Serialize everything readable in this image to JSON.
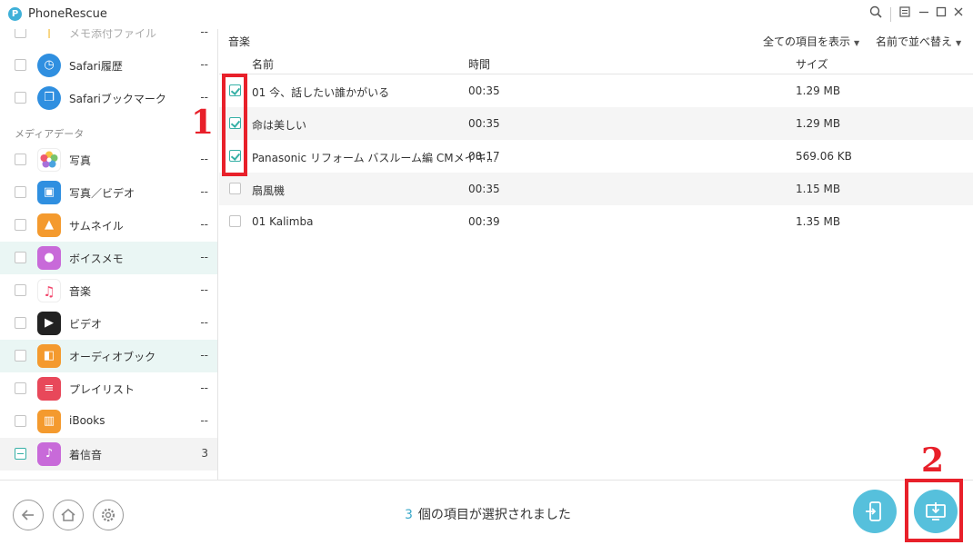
{
  "app": {
    "title": "PhoneRescue",
    "logo_letter": "P"
  },
  "sidebar": {
    "section_media": "メディアデータ",
    "items": [
      {
        "label": "メモ添付ファイル",
        "count": "--",
        "icon": "attachment-icon",
        "color": "#f4c24a",
        "checked": "none"
      },
      {
        "label": "Safari履歴",
        "count": "--",
        "icon": "safari-history-icon",
        "color": "#2f8fe0",
        "checked": "none"
      },
      {
        "label": "Safariブックマーク",
        "count": "--",
        "icon": "safari-bookmark-icon",
        "color": "#2f8fe0",
        "checked": "none"
      },
      {
        "label": "写真",
        "count": "--",
        "icon": "photos-icon",
        "color": "#ffffff",
        "checked": "none"
      },
      {
        "label": "写真／ビデオ",
        "count": "--",
        "icon": "photo-video-icon",
        "color": "#2f8fe0",
        "checked": "none"
      },
      {
        "label": "サムネイル",
        "count": "--",
        "icon": "thumbnail-icon",
        "color": "#f49a2e",
        "checked": "none"
      },
      {
        "label": "ボイスメモ",
        "count": "--",
        "icon": "voice-memo-icon",
        "color": "#c86ad9",
        "checked": "none"
      },
      {
        "label": "音楽",
        "count": "--",
        "icon": "music-icon",
        "color": "#ffffff",
        "checked": "none"
      },
      {
        "label": "ビデオ",
        "count": "--",
        "icon": "video-icon",
        "color": "#222222",
        "checked": "none"
      },
      {
        "label": "オーディオブック",
        "count": "--",
        "icon": "audiobook-icon",
        "color": "#f49a2e",
        "checked": "none"
      },
      {
        "label": "プレイリスト",
        "count": "--",
        "icon": "playlist-icon",
        "color": "#e8485a",
        "checked": "none"
      },
      {
        "label": "iBooks",
        "count": "--",
        "icon": "ibooks-icon",
        "color": "#f49a2e",
        "checked": "none"
      },
      {
        "label": "着信音",
        "count": "3",
        "icon": "ringtone-icon",
        "color": "#c86ad9",
        "checked": "partial"
      }
    ]
  },
  "main": {
    "breadcrumb": "音楽",
    "filter_label": "全ての項目を表示",
    "sort_label": "名前で並べ替え",
    "columns": {
      "name": "名前",
      "time": "時間",
      "size": "サイズ"
    },
    "rows": [
      {
        "name": "01 今、話したい誰かがいる",
        "time": "00:35",
        "size": "1.29 MB",
        "checked": true
      },
      {
        "name": "命は美しい",
        "time": "00:35",
        "size": "1.29 MB",
        "checked": true
      },
      {
        "name": "Panasonic リフォーム バスルーム編 CMメイキ...",
        "time": "00:17",
        "size": "569.06 KB",
        "checked": true
      },
      {
        "name": "扇風機",
        "time": "00:35",
        "size": "1.15 MB",
        "checked": false
      },
      {
        "name": "01 Kalimba",
        "time": "00:39",
        "size": "1.35 MB",
        "checked": false
      }
    ]
  },
  "footer": {
    "selected_count": "3",
    "selected_text": "個の項目が選択されました"
  },
  "annotations": {
    "one": "1",
    "two": "2"
  },
  "colors": {
    "accent": "#36b0a6",
    "highlight": "#e8202a",
    "action": "#56c0dc"
  }
}
